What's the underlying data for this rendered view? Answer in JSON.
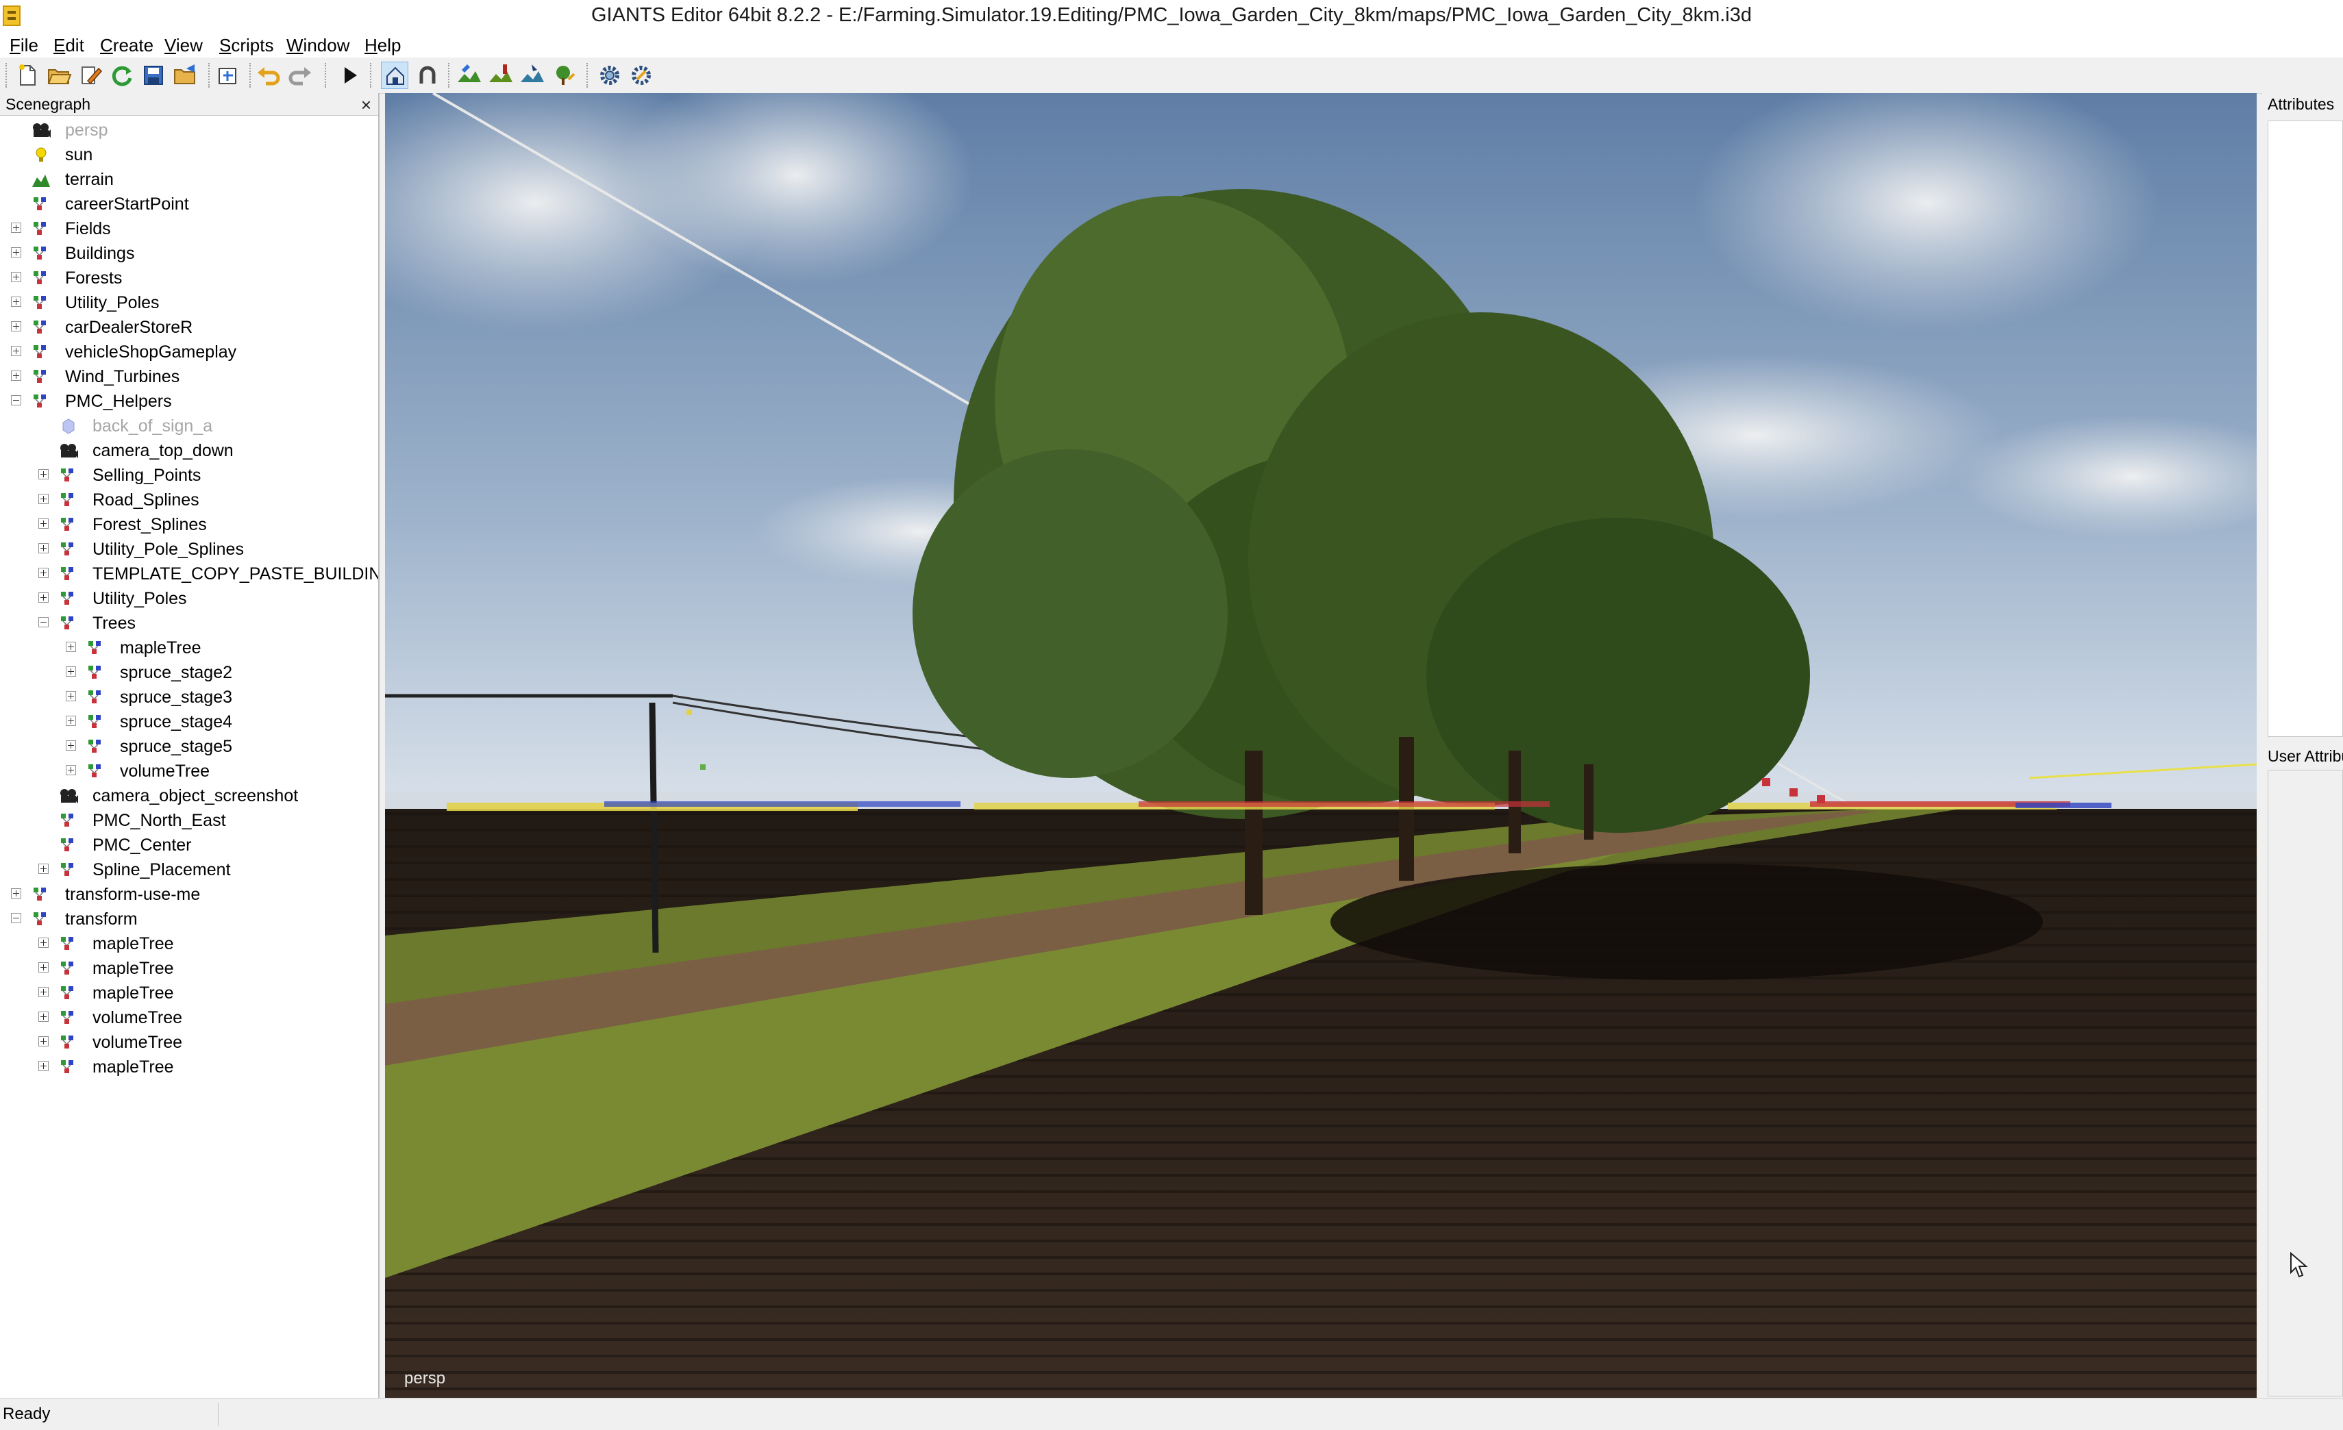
{
  "window": {
    "title": "GIANTS Editor 64bit 8.2.2 - E:/Farming.Simulator.19.Editing/PMC_Iowa_Garden_City_8km/maps/PMC_Iowa_Garden_City_8km.i3d"
  },
  "menu": [
    {
      "mnemonic": "F",
      "rest": "ile"
    },
    {
      "mnemonic": "E",
      "rest": "dit"
    },
    {
      "mnemonic": "C",
      "rest": "reate"
    },
    {
      "mnemonic": "V",
      "rest": "iew"
    },
    {
      "mnemonic": "S",
      "rest": "cripts"
    },
    {
      "mnemonic": "W",
      "rest": "indow"
    },
    {
      "mnemonic": "H",
      "rest": "elp"
    }
  ],
  "toolbar": {
    "icons": [
      "new-file-icon",
      "open-folder-icon",
      "edit-icon",
      "reload-icon",
      "save-icon",
      "export-icon",
      "import-icon",
      "undo-icon",
      "redo-icon",
      "play-icon",
      "home-select-icon",
      "magnet-icon",
      "terrain-paint-icon",
      "foliage-paint-icon",
      "terrain-sculpt-icon",
      "tree-paint-icon",
      "settings-icon",
      "tools-icon"
    ],
    "active": "home-select-icon"
  },
  "scenegraph": {
    "title": "Scenegraph",
    "close_glyph": "×",
    "nodes": [
      {
        "label": "persp",
        "type": "camera",
        "depth": 0,
        "expander": "none",
        "dim": true
      },
      {
        "label": "sun",
        "type": "light",
        "depth": 0,
        "expander": "none"
      },
      {
        "label": "terrain",
        "type": "terrain",
        "depth": 0,
        "expander": "none"
      },
      {
        "label": "careerStartPoint",
        "type": "transform",
        "depth": 0,
        "expander": "none"
      },
      {
        "label": "Fields",
        "type": "transform",
        "depth": 0,
        "expander": "plus"
      },
      {
        "label": "Buildings",
        "type": "transform",
        "depth": 0,
        "expander": "plus"
      },
      {
        "label": "Forests",
        "type": "transform",
        "depth": 0,
        "expander": "plus"
      },
      {
        "label": "Utility_Poles",
        "type": "transform",
        "depth": 0,
        "expander": "plus"
      },
      {
        "label": "carDealerStoreR",
        "type": "transform",
        "depth": 0,
        "expander": "plus"
      },
      {
        "label": "vehicleShopGameplay",
        "type": "transform",
        "depth": 0,
        "expander": "plus"
      },
      {
        "label": "Wind_Turbines",
        "type": "transform",
        "depth": 0,
        "expander": "plus"
      },
      {
        "label": "PMC_Helpers",
        "type": "transform",
        "depth": 0,
        "expander": "minus"
      },
      {
        "label": "back_of_sign_a",
        "type": "shape",
        "depth": 1,
        "expander": "none",
        "dim": true
      },
      {
        "label": "camera_top_down",
        "type": "camera",
        "depth": 1,
        "expander": "none"
      },
      {
        "label": "Selling_Points",
        "type": "transform",
        "depth": 1,
        "expander": "plus"
      },
      {
        "label": "Road_Splines",
        "type": "transform",
        "depth": 1,
        "expander": "plus"
      },
      {
        "label": "Forest_Splines",
        "type": "transform",
        "depth": 1,
        "expander": "plus"
      },
      {
        "label": "Utility_Pole_Splines",
        "type": "transform",
        "depth": 1,
        "expander": "plus"
      },
      {
        "label": "TEMPLATE_COPY_PASTE_BUILDING",
        "type": "transform",
        "depth": 1,
        "expander": "plus"
      },
      {
        "label": "Utility_Poles",
        "type": "transform",
        "depth": 1,
        "expander": "plus"
      },
      {
        "label": "Trees",
        "type": "transform",
        "depth": 1,
        "expander": "minus"
      },
      {
        "label": "mapleTree",
        "type": "transform",
        "depth": 2,
        "expander": "plus"
      },
      {
        "label": "spruce_stage2",
        "type": "transform",
        "depth": 2,
        "expander": "plus"
      },
      {
        "label": "spruce_stage3",
        "type": "transform",
        "depth": 2,
        "expander": "plus"
      },
      {
        "label": "spruce_stage4",
        "type": "transform",
        "depth": 2,
        "expander": "plus"
      },
      {
        "label": "spruce_stage5",
        "type": "transform",
        "depth": 2,
        "expander": "plus"
      },
      {
        "label": "volumeTree",
        "type": "transform",
        "depth": 2,
        "expander": "plus"
      },
      {
        "label": "camera_object_screenshot",
        "type": "camera",
        "depth": 1,
        "expander": "none"
      },
      {
        "label": "PMC_North_East",
        "type": "transform",
        "depth": 1,
        "expander": "none"
      },
      {
        "label": "PMC_Center",
        "type": "transform",
        "depth": 1,
        "expander": "none"
      },
      {
        "label": "Spline_Placement",
        "type": "transform",
        "depth": 1,
        "expander": "plus"
      },
      {
        "label": "transform-use-me",
        "type": "transform",
        "depth": 0,
        "expander": "plus"
      },
      {
        "label": "transform",
        "type": "transform",
        "depth": 0,
        "expander": "minus"
      },
      {
        "label": "mapleTree",
        "type": "transform",
        "depth": 1,
        "expander": "plus"
      },
      {
        "label": "mapleTree",
        "type": "transform",
        "depth": 1,
        "expander": "plus"
      },
      {
        "label": "mapleTree",
        "type": "transform",
        "depth": 1,
        "expander": "plus"
      },
      {
        "label": "volumeTree",
        "type": "transform",
        "depth": 1,
        "expander": "plus"
      },
      {
        "label": "volumeTree",
        "type": "transform",
        "depth": 1,
        "expander": "plus"
      },
      {
        "label": "mapleTree",
        "type": "transform",
        "depth": 1,
        "expander": "plus"
      }
    ]
  },
  "viewport": {
    "camera_label": "persp",
    "sky_top_color": "#5f7ea6",
    "horizon_color": "#d9e1ea",
    "foliage_color": "#3d5a24",
    "soil_color": "#2a1f18"
  },
  "attributes": {
    "title": "Attributes"
  },
  "user_attributes": {
    "title": "User Attributes"
  },
  "status": {
    "text": "Ready"
  }
}
